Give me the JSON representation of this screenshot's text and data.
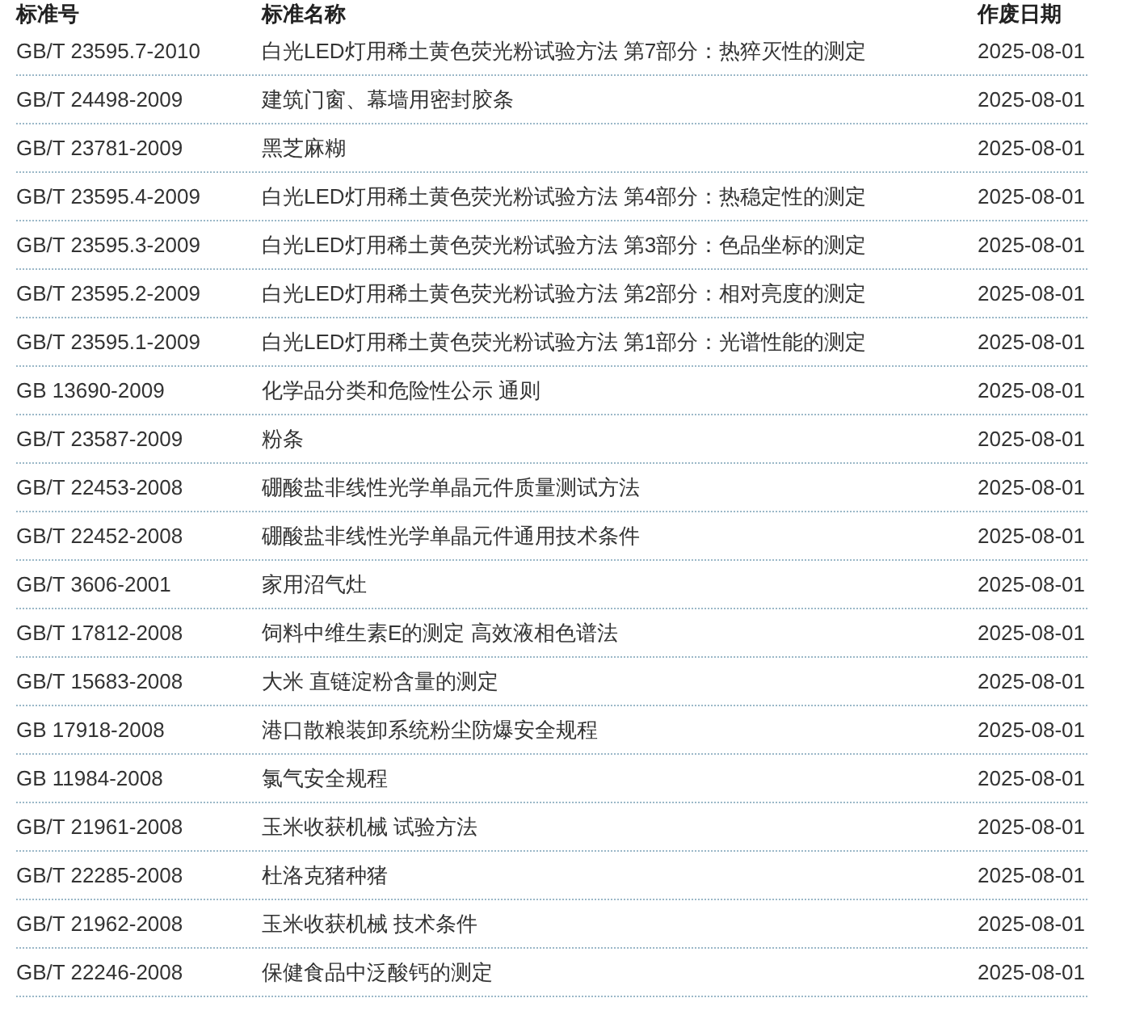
{
  "table": {
    "columns": [
      "标准号",
      "标准名称",
      "作废日期"
    ],
    "rows": [
      [
        "GB/T 23595.7-2010",
        "白光LED灯用稀土黄色荧光粉试验方法 第7部分：热猝灭性的测定",
        "2025-08-01"
      ],
      [
        "GB/T 24498-2009",
        "建筑门窗、幕墙用密封胶条",
        "2025-08-01"
      ],
      [
        "GB/T 23781-2009",
        "黑芝麻糊",
        "2025-08-01"
      ],
      [
        "GB/T 23595.4-2009",
        "白光LED灯用稀土黄色荧光粉试验方法 第4部分：热稳定性的测定",
        "2025-08-01"
      ],
      [
        "GB/T 23595.3-2009",
        "白光LED灯用稀土黄色荧光粉试验方法 第3部分：色品坐标的测定",
        "2025-08-01"
      ],
      [
        "GB/T 23595.2-2009",
        "白光LED灯用稀土黄色荧光粉试验方法 第2部分：相对亮度的测定",
        "2025-08-01"
      ],
      [
        "GB/T 23595.1-2009",
        "白光LED灯用稀土黄色荧光粉试验方法 第1部分：光谱性能的测定",
        "2025-08-01"
      ],
      [
        "GB 13690-2009",
        "化学品分类和危险性公示 通则",
        "2025-08-01"
      ],
      [
        "GB/T 23587-2009",
        "粉条",
        "2025-08-01"
      ],
      [
        "GB/T 22453-2008",
        "硼酸盐非线性光学单晶元件质量测试方法",
        "2025-08-01"
      ],
      [
        "GB/T 22452-2008",
        "硼酸盐非线性光学单晶元件通用技术条件",
        "2025-08-01"
      ],
      [
        "GB/T 3606-2001",
        "家用沼气灶",
        "2025-08-01"
      ],
      [
        "GB/T 17812-2008",
        "饲料中维生素E的测定 高效液相色谱法",
        "2025-08-01"
      ],
      [
        "GB/T 15683-2008",
        "大米 直链淀粉含量的测定",
        "2025-08-01"
      ],
      [
        "GB 17918-2008",
        "港口散粮装卸系统粉尘防爆安全规程",
        "2025-08-01"
      ],
      [
        "GB 11984-2008",
        "氯气安全规程",
        "2025-08-01"
      ],
      [
        "GB/T 21961-2008",
        "玉米收获机械 试验方法",
        "2025-08-01"
      ],
      [
        "GB/T 22285-2008",
        "杜洛克猪种猪",
        "2025-08-01"
      ],
      [
        "GB/T 21962-2008",
        "玉米收获机械 技术条件",
        "2025-08-01"
      ],
      [
        "GB/T 22246-2008",
        "保健食品中泛酸钙的测定",
        "2025-08-01"
      ]
    ]
  }
}
